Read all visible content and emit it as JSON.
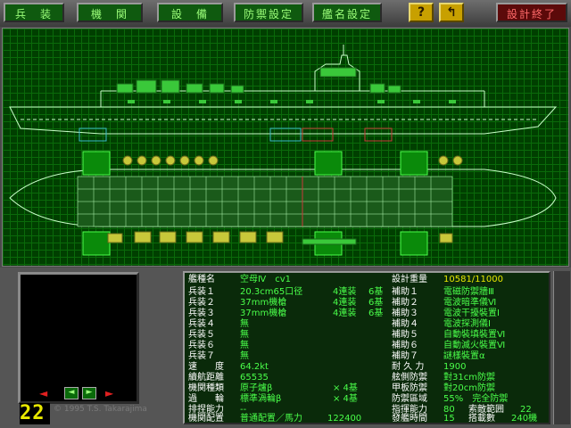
{
  "toolbar": {
    "buttons": [
      "兵　装",
      "機　関",
      "設　備",
      "防禦設定",
      "艦名設定"
    ],
    "help_label": "?",
    "undo_label": "↰",
    "exit_label": "設計終了"
  },
  "counter": "22",
  "credit": "© 1995 T.S. Takarajima",
  "colors": {
    "grid": "#003f00",
    "line": "#c8ffc8",
    "turret": "#3ac83a",
    "value": "#4aff4a",
    "header": "#e8e800"
  },
  "specs": {
    "class_label": "艦種名",
    "class_value": "空母Ⅳ　cv1",
    "weight_label": "設計重量",
    "weight_value": "10581/11000",
    "weapons": [
      {
        "label": "兵装１",
        "name": "20.3cm65口径",
        "mount": "4連装",
        "count": "6基"
      },
      {
        "label": "兵装２",
        "name": "37mm機槍",
        "mount": "4連装",
        "count": "6基"
      },
      {
        "label": "兵装３",
        "name": "37mm機槍",
        "mount": "4連装",
        "count": "6基"
      },
      {
        "label": "兵装４",
        "name": "無",
        "mount": "",
        "count": ""
      },
      {
        "label": "兵装５",
        "name": "無",
        "mount": "",
        "count": ""
      },
      {
        "label": "兵装６",
        "name": "無",
        "mount": "",
        "count": ""
      },
      {
        "label": "兵装７",
        "name": "無",
        "mount": "",
        "count": ""
      }
    ],
    "aux": [
      {
        "label": "補助１",
        "value": "電磁防禦牆Ⅲ"
      },
      {
        "label": "補助２",
        "value": "電波暗準儀Ⅵ"
      },
      {
        "label": "補助３",
        "value": "電波干擾裝置Ⅰ"
      },
      {
        "label": "補助４",
        "value": "電波探測儀Ⅰ"
      },
      {
        "label": "補助５",
        "value": "自動裝填裝置Ⅵ"
      },
      {
        "label": "補助６",
        "value": "自動滅火裝置Ⅵ"
      },
      {
        "label": "補助７",
        "value": "謎樣裝置α"
      }
    ],
    "speed_label": "速　　度",
    "speed_value": "64.2kt",
    "range_label": "續航距離",
    "range_value": "65535",
    "engine_label": "機関種類",
    "engine_value": "原子爐β",
    "engine_count": "× 4基",
    "turbine_label": "過　　輪",
    "turbine_value": "標準渦輪β",
    "turbine_count": "× 4基",
    "displacement_label": "排捏能力",
    "displacement_value": "--",
    "layout_label": "機関配置",
    "layout_value": "普通配置／馬力",
    "layout_power": "122400",
    "durability_label": "耐 久 力",
    "durability_value": "1900",
    "side_armor_label": "舷側防禦",
    "side_armor_value": "對31cm防禦",
    "deck_armor_label": "甲板防禦",
    "deck_armor_value": "對20cm防禦",
    "defense_label": "防禦區域",
    "defense_value": "55%　完全防禦",
    "command_label": "指揮能力",
    "command_value": "80",
    "enemy_range_label": "索敵範囲",
    "enemy_range_value": "22",
    "launch_label": "發艦時間",
    "launch_value": "15",
    "aircraft_label": "搭載數",
    "aircraft_value": "240機"
  }
}
